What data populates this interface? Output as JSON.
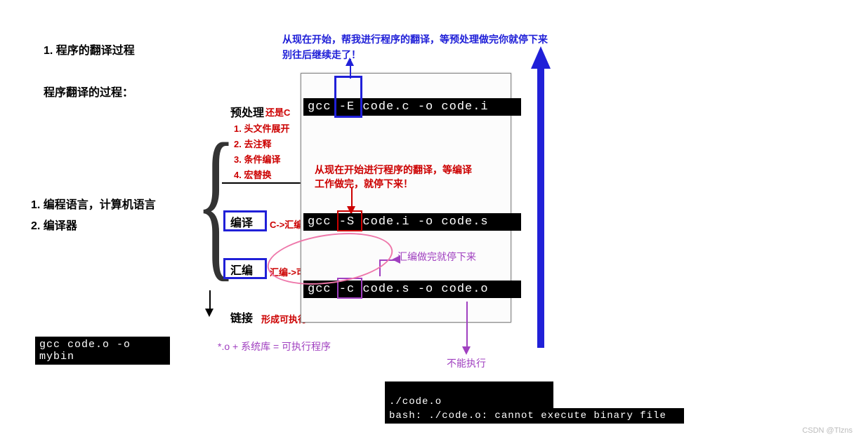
{
  "heading": {
    "main": "1. 程序的翻译过程",
    "sub": "程序翻译的过程：",
    "left1": "1. 编程语言，计算机语言",
    "left2": "2. 编译器"
  },
  "blue_top": {
    "line1": "从现在开始，帮我进行程序的翻译，等预处理做完你就停下来",
    "line2": "别往后继续走了！"
  },
  "stages": {
    "pre": "预处理",
    "pre_note": "还是C",
    "pre_items": [
      "1. 头文件展开",
      "2. 去注释",
      "3. 条件编译",
      "4. 宏替换"
    ],
    "compile": "编译",
    "compile_note": "C->汇编",
    "compile_redtext1": "从现在开始进行程序的翻译，等编译",
    "compile_redtext2": "工作做完，就停下来！",
    "asm": "汇编",
    "asm_note": "汇编->可重定位二进制文件",
    "asm_purple": "汇编做完就停下来",
    "link": "链接",
    "link_note": "形成可执行"
  },
  "commands": {
    "preprocess": "gcc  -E  code.c -o code.i",
    "compile": "gcc  -S  code.i -o code.s",
    "assemble": "gcc  -c  code.s -o code.o",
    "link": "gcc code.o -o mybin"
  },
  "footer": {
    "lib": "*.o + 系统库 = 可执行程序",
    "cant": "不能执行",
    "term1": "./code.o",
    "term2": "bash: ./code.o: cannot execute binary file"
  },
  "watermark": "CSDN @Tlzns"
}
